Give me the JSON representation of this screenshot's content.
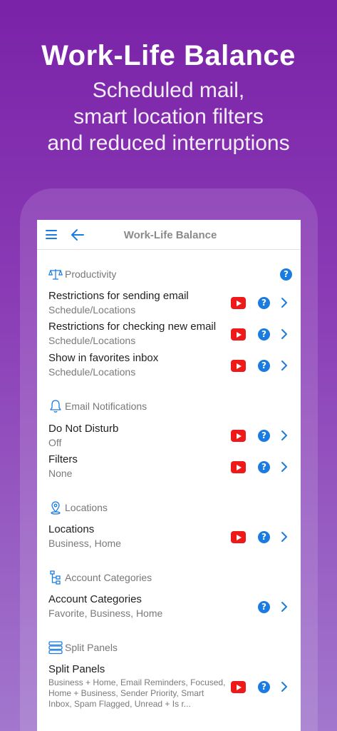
{
  "promo": {
    "title": "Work-Life Balance",
    "subtitle_lines": [
      "Scheduled mail,",
      "smart location filters",
      "and reduced interruptions"
    ]
  },
  "navbar": {
    "title": "Work-Life Balance"
  },
  "accent_color": "#1a7be0",
  "youtube_color": "#ee1a1a",
  "sections": [
    {
      "label": "Productivity",
      "icon": "scales-icon",
      "rows": [
        {
          "title": "Restrictions for sending email",
          "subtitle": "Schedule/Locations",
          "video": true
        },
        {
          "title": "Restrictions for checking new email",
          "subtitle": "Schedule/Locations",
          "video": true
        },
        {
          "title": "Show in favorites inbox",
          "subtitle": "Schedule/Locations",
          "video": true
        }
      ]
    },
    {
      "label": "Email Notifications",
      "icon": "bell-icon",
      "rows": [
        {
          "title": "Do Not Disturb",
          "subtitle": "Off",
          "video": true
        },
        {
          "title": "Filters",
          "subtitle": "None",
          "video": true
        }
      ]
    },
    {
      "label": "Locations",
      "icon": "location-pin-icon",
      "rows": [
        {
          "title": "Locations",
          "subtitle": "Business, Home",
          "video": true
        }
      ]
    },
    {
      "label": "Account Categories",
      "icon": "hierarchy-icon",
      "rows": [
        {
          "title": "Account Categories",
          "subtitle": "Favorite, Business, Home",
          "video": false
        }
      ]
    },
    {
      "label": "Split Panels",
      "icon": "split-panels-icon",
      "rows": [
        {
          "title": "Split Panels",
          "subtitle": "Business + Home, Email Reminders, Focused, Home + Business, Sender Priority, Smart Inbox, Spam Flagged, Unread + Is r...",
          "video": true
        }
      ]
    }
  ],
  "help_glyph": "?"
}
